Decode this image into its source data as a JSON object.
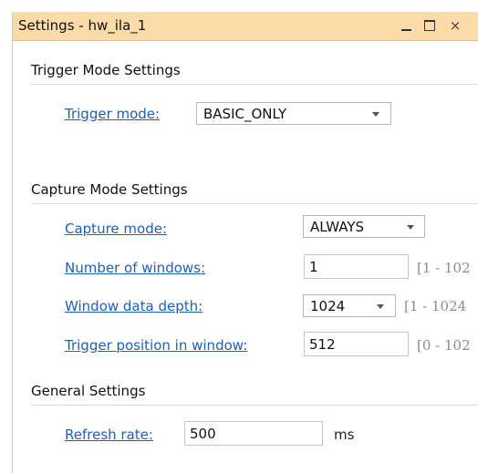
{
  "window": {
    "title": "Settings - hw_ila_1",
    "controls": {
      "minimize_icon": "minimize-icon",
      "maximize_icon": "maximize-icon",
      "close_icon": "close-icon"
    }
  },
  "trigger_section": {
    "heading": "Trigger Mode Settings",
    "trigger_mode": {
      "label": "Trigger mode:",
      "value": "BASIC_ONLY"
    }
  },
  "capture_section": {
    "heading": "Capture Mode Settings",
    "capture_mode": {
      "label": "Capture mode:",
      "value": "ALWAYS"
    },
    "number_of_windows": {
      "label": "Number of windows:",
      "value": "1",
      "range": "[1 - 102"
    },
    "window_data_depth": {
      "label": "Window data depth:",
      "value": "1024",
      "range": "[1 - 1024"
    },
    "trigger_position": {
      "label": "Trigger position in window:",
      "value": "512",
      "range": "[0 - 102"
    }
  },
  "general_section": {
    "heading": "General Settings",
    "refresh_rate": {
      "label": "Refresh rate:",
      "value": "500",
      "unit": "ms"
    }
  },
  "colors": {
    "titlebar": "#fbdba7",
    "link": "#1f5fb4",
    "range_text": "#8c8c8c"
  }
}
